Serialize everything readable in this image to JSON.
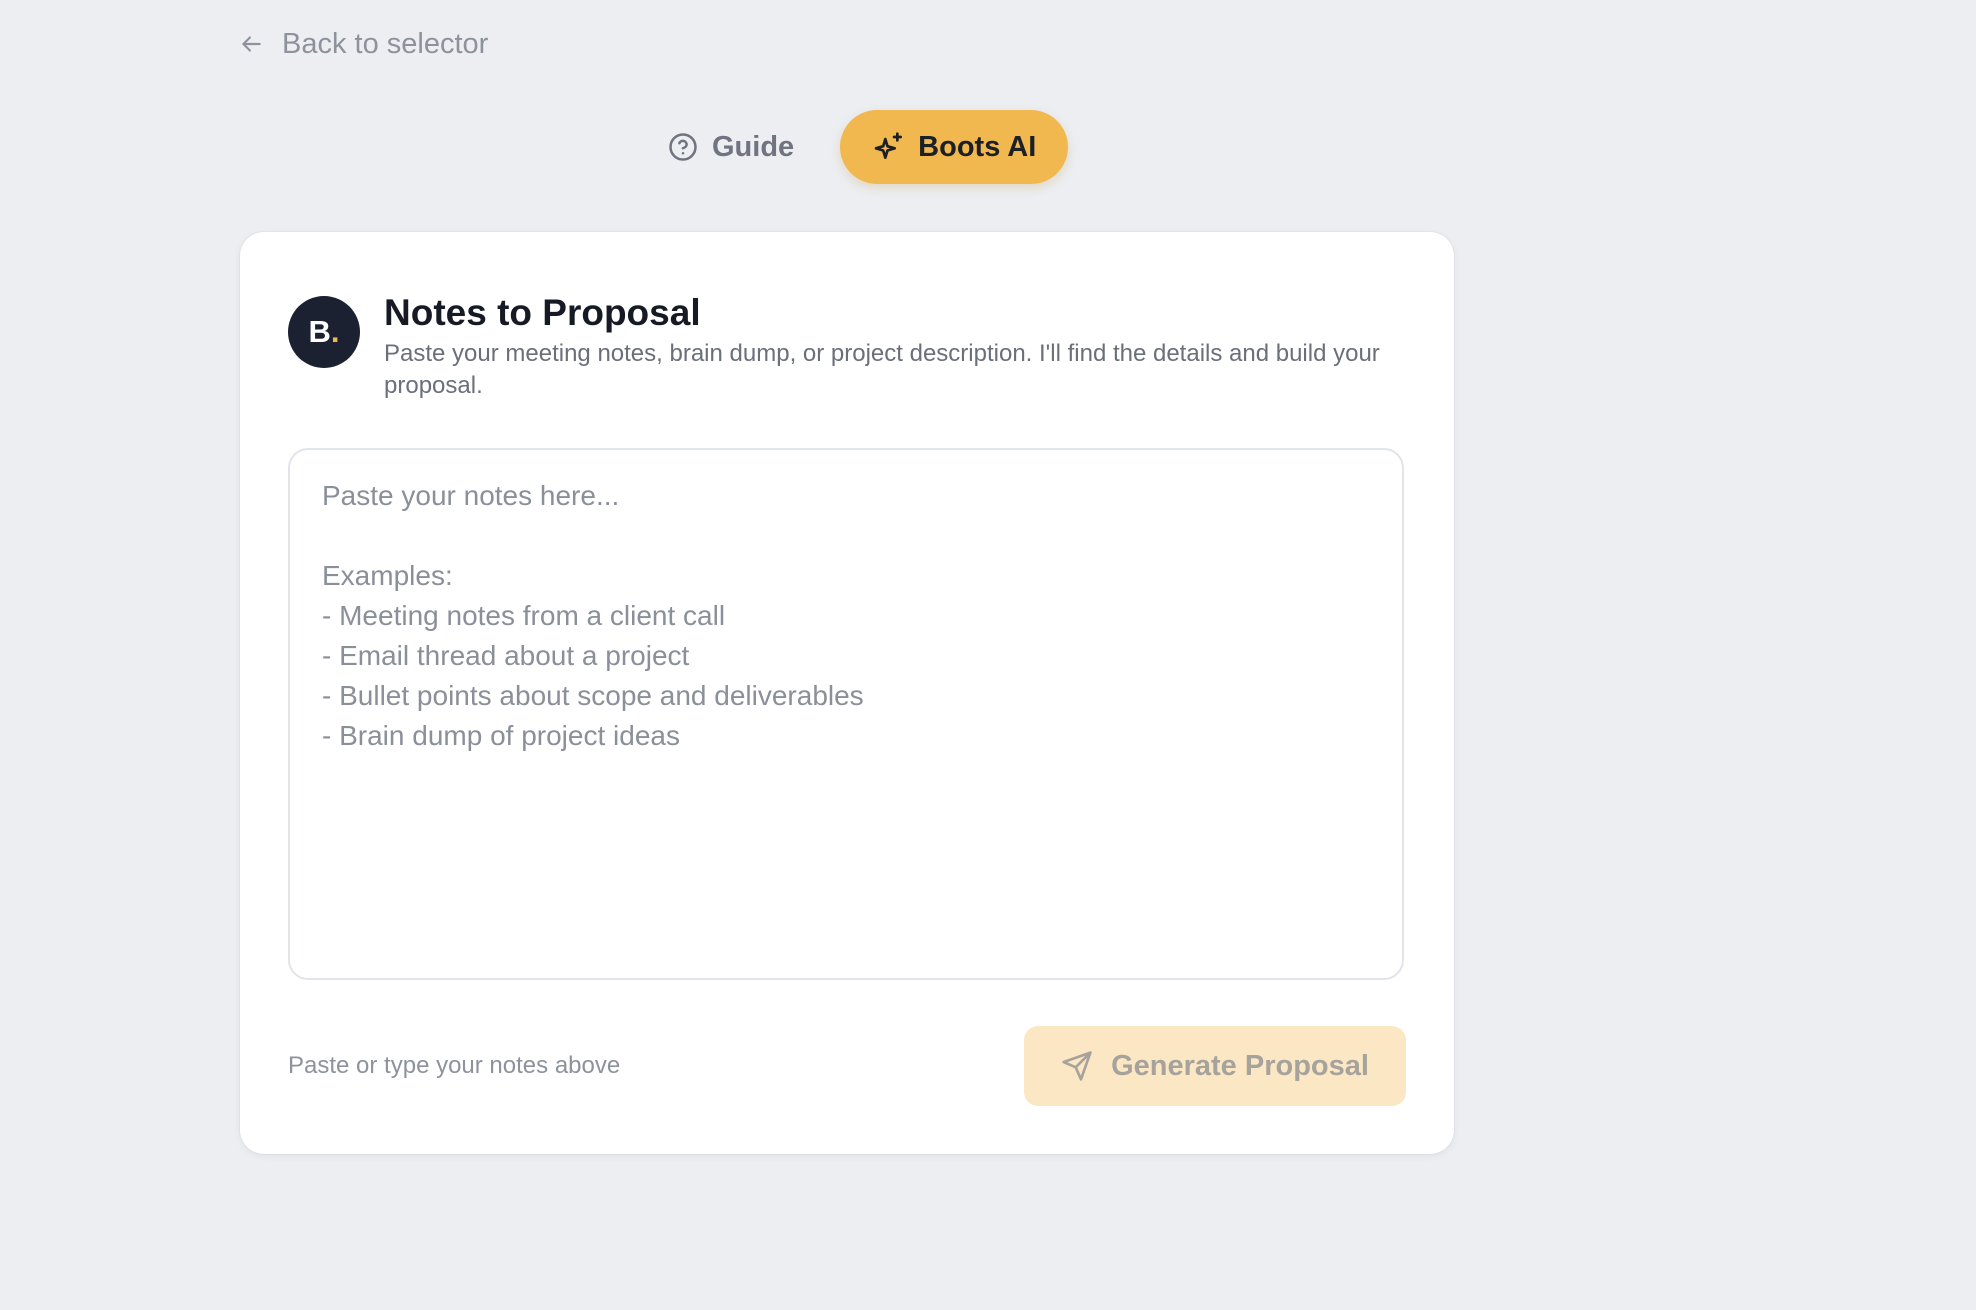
{
  "nav": {
    "back_label": "Back to selector",
    "back_icon": "arrow-left-icon"
  },
  "modes": {
    "guide_label": "Guide",
    "guide_icon": "help-circle-icon",
    "boots_label": "Boots AI",
    "boots_icon": "sparkles-icon",
    "active": "Boots AI"
  },
  "card": {
    "avatar_letter": "B",
    "avatar_dot": ".",
    "title": "Notes to Proposal",
    "subtitle": "Paste your meeting notes, brain dump, or project description. I'll find the details and build your proposal.",
    "notes_value": "",
    "notes_placeholder": "Paste your notes here...\n\nExamples:\n- Meeting notes from a client call\n- Email thread about a project\n- Bullet points about scope and deliverables\n- Brain dump of project ideas",
    "hint": "Paste or type your notes above",
    "generate_label": "Generate Proposal",
    "generate_icon": "send-icon",
    "generate_disabled": true
  },
  "colors": {
    "background": "#eceef2",
    "accent": "#f0b84f",
    "accent_disabled": "#fbe7c3",
    "avatar_bg": "#1b2130"
  }
}
